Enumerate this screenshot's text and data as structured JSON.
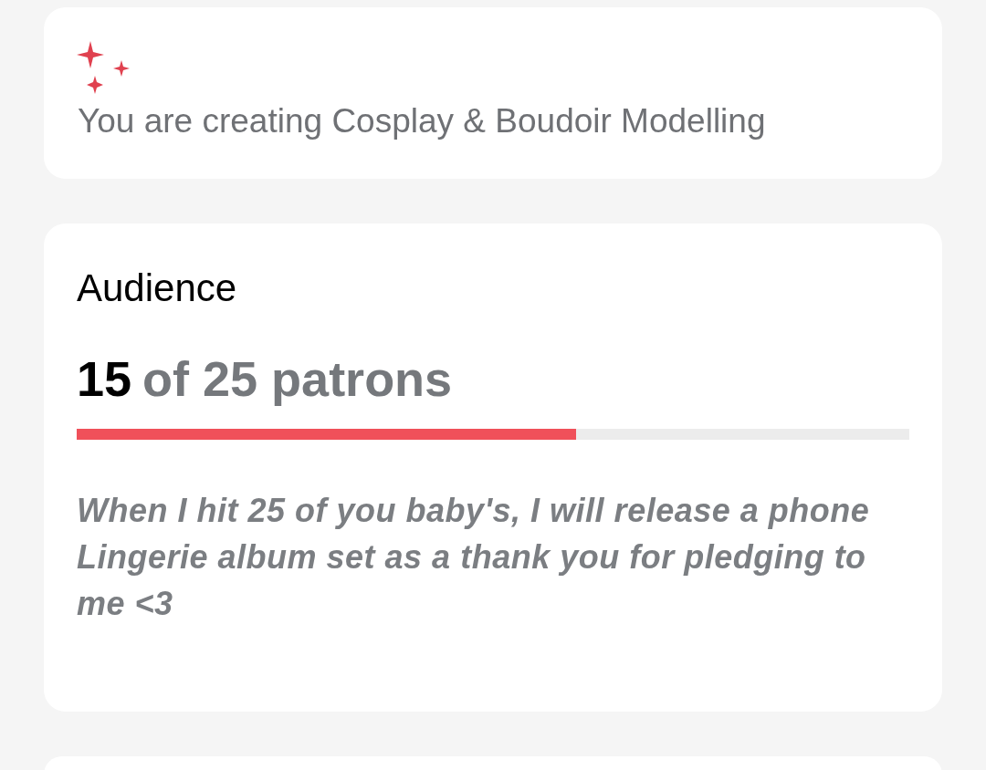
{
  "creating_card": {
    "text": "You are creating Cosplay & Boudoir Modelling"
  },
  "goal_card": {
    "title": "Audience",
    "count": "15",
    "target": "of 25 patrons",
    "level": 0.6,
    "description": "When I hit 25 of you baby's, I will release a phone Lingerie album set as a thank you for pledging to me <3"
  }
}
